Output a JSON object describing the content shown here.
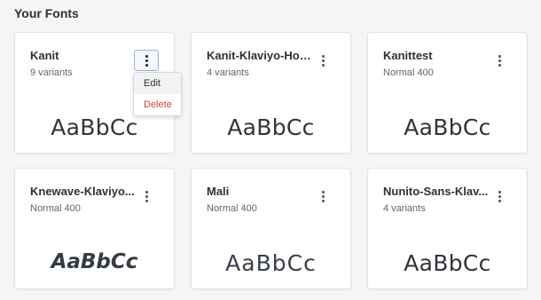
{
  "section_title": "Your Fonts",
  "menu": {
    "edit": "Edit",
    "delete": "Delete"
  },
  "cards": [
    {
      "name": "Kanit",
      "variants": "9 variants",
      "sample": "AaBbCc"
    },
    {
      "name": "Kanit-Klaviyo-Hos...",
      "variants": "4 variants",
      "sample": "AaBbCc"
    },
    {
      "name": "Kanittest",
      "variants": "Normal 400",
      "sample": "AaBbCc"
    },
    {
      "name": "Knewave-Klaviyo...",
      "variants": "Normal 400",
      "sample": "AaBbCc"
    },
    {
      "name": "Mali",
      "variants": "Normal 400",
      "sample": "AaBbCc"
    },
    {
      "name": "Nunito-Sans-Klav...",
      "variants": "4 variants",
      "sample": "AaBbCc"
    }
  ],
  "colors": {
    "delete": "#d1442e",
    "active_border": "#9bb3d1"
  }
}
